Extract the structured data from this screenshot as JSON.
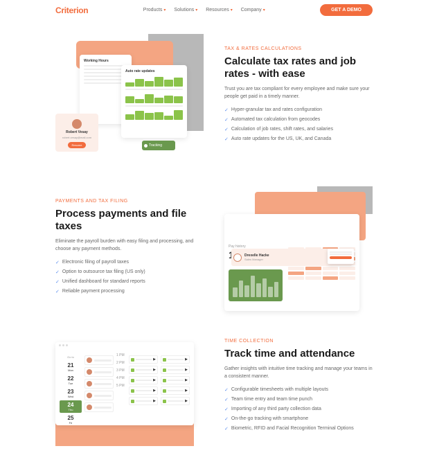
{
  "brand": "Criterion",
  "nav": {
    "items": [
      {
        "label": "Products"
      },
      {
        "label": "Solutions"
      },
      {
        "label": "Resources"
      },
      {
        "label": "Company"
      }
    ],
    "cta": "GET A DEMO"
  },
  "section1": {
    "eyebrow": "TAX & RATES CALCULATIONS",
    "heading": "Calculate tax rates and job rates - with ease",
    "desc": "Trust you are tax compliant for every employee and make sure your people get paid in a timely manner.",
    "features": [
      "Hyper-granular tax and rates configuration",
      "Automated tax calculation from geocodes",
      "Calculation of job rates, shift rates, and salaries",
      "Auto rate updates for the US, UK, and Canada"
    ],
    "mock": {
      "card1_title": "Working Hours",
      "card2_title": "Auto rate updates",
      "person_name": "Robert Vesay",
      "person_email": "robert.vesay@mail.com",
      "person_btn": "Resume",
      "tag": "Tracking"
    }
  },
  "section2": {
    "eyebrow": "PAYMENTS AND TAX FILING",
    "heading": "Process payments and file taxes",
    "desc": "Eliminate the payroll burden with easy filing and processing, and choose any payment methods.",
    "features": [
      "Electronic filing of payroll taxes",
      "Option to outsource tax filing (US only)",
      "Unified dashboard for standard reports",
      "Reliable payment processing"
    ],
    "mock": {
      "name": "Drexelle Hacke",
      "role": "Sales Manager",
      "stat_label": "Pay history",
      "stat_value": "135"
    }
  },
  "section3": {
    "eyebrow": "TIME COLLECTION",
    "heading": "Track time and attendance",
    "desc": "Gather insights with intuitive time tracking and manage your teams in a consistent manner.",
    "features": [
      "Configurable timesheets with multiple layouts",
      "Team time entry and team time punch",
      "Importing of any third party collection data",
      "On-the-go tracking with smartphone",
      "Biometric, RFID and Facial Recognition Terminal Options"
    ],
    "mock": {
      "month_label": "Go to",
      "days": [
        {
          "num": "21",
          "dow": "Mon"
        },
        {
          "num": "22",
          "dow": "Tue"
        },
        {
          "num": "23",
          "dow": "Wed"
        },
        {
          "num": "24",
          "dow": "Thu"
        },
        {
          "num": "25",
          "dow": "Fri"
        }
      ],
      "active_day": 3,
      "hours": [
        "1 PM",
        "2 PM",
        "3 PM",
        "4 PM",
        "5 PM"
      ]
    }
  }
}
